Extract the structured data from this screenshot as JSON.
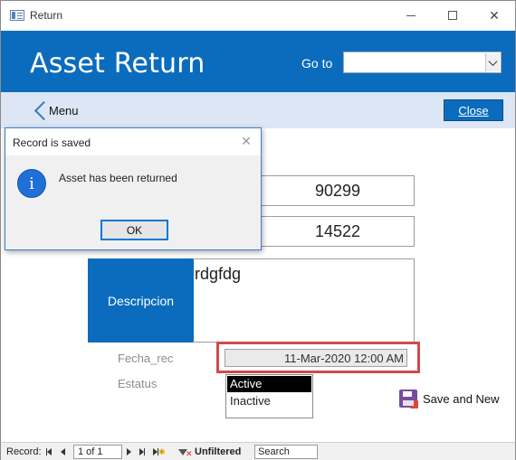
{
  "window": {
    "title": "Return"
  },
  "header": {
    "title": "Asset Return",
    "goto_label": "Go to",
    "goto_value": ""
  },
  "nav": {
    "menu_label": "Menu",
    "close_label": "Close"
  },
  "form": {
    "field1_value": "90299",
    "field2_value": "14522",
    "descripcion_label": "Descripcion",
    "descripcion_value": "rdgfdg",
    "fecha_label": "Fecha_rec",
    "fecha_value": "11-Mar-2020 12:00 AM",
    "estatus_label": "Estatus",
    "estatus_options": [
      "Active",
      "Inactive"
    ],
    "estatus_selected": "Active",
    "save_new_label": "Save and New"
  },
  "statusbar": {
    "record_label": "Record:",
    "position": "1 of 1",
    "filter_label": "Unfiltered",
    "search_placeholder": "Search"
  },
  "dialog": {
    "title": "Record is saved",
    "message": "Asset has been returned",
    "ok_label": "OK",
    "icon": "info-icon"
  },
  "colors": {
    "accent": "#0b6cbd",
    "nav_bg": "#dce6f4",
    "highlight": "#d24a4a"
  }
}
